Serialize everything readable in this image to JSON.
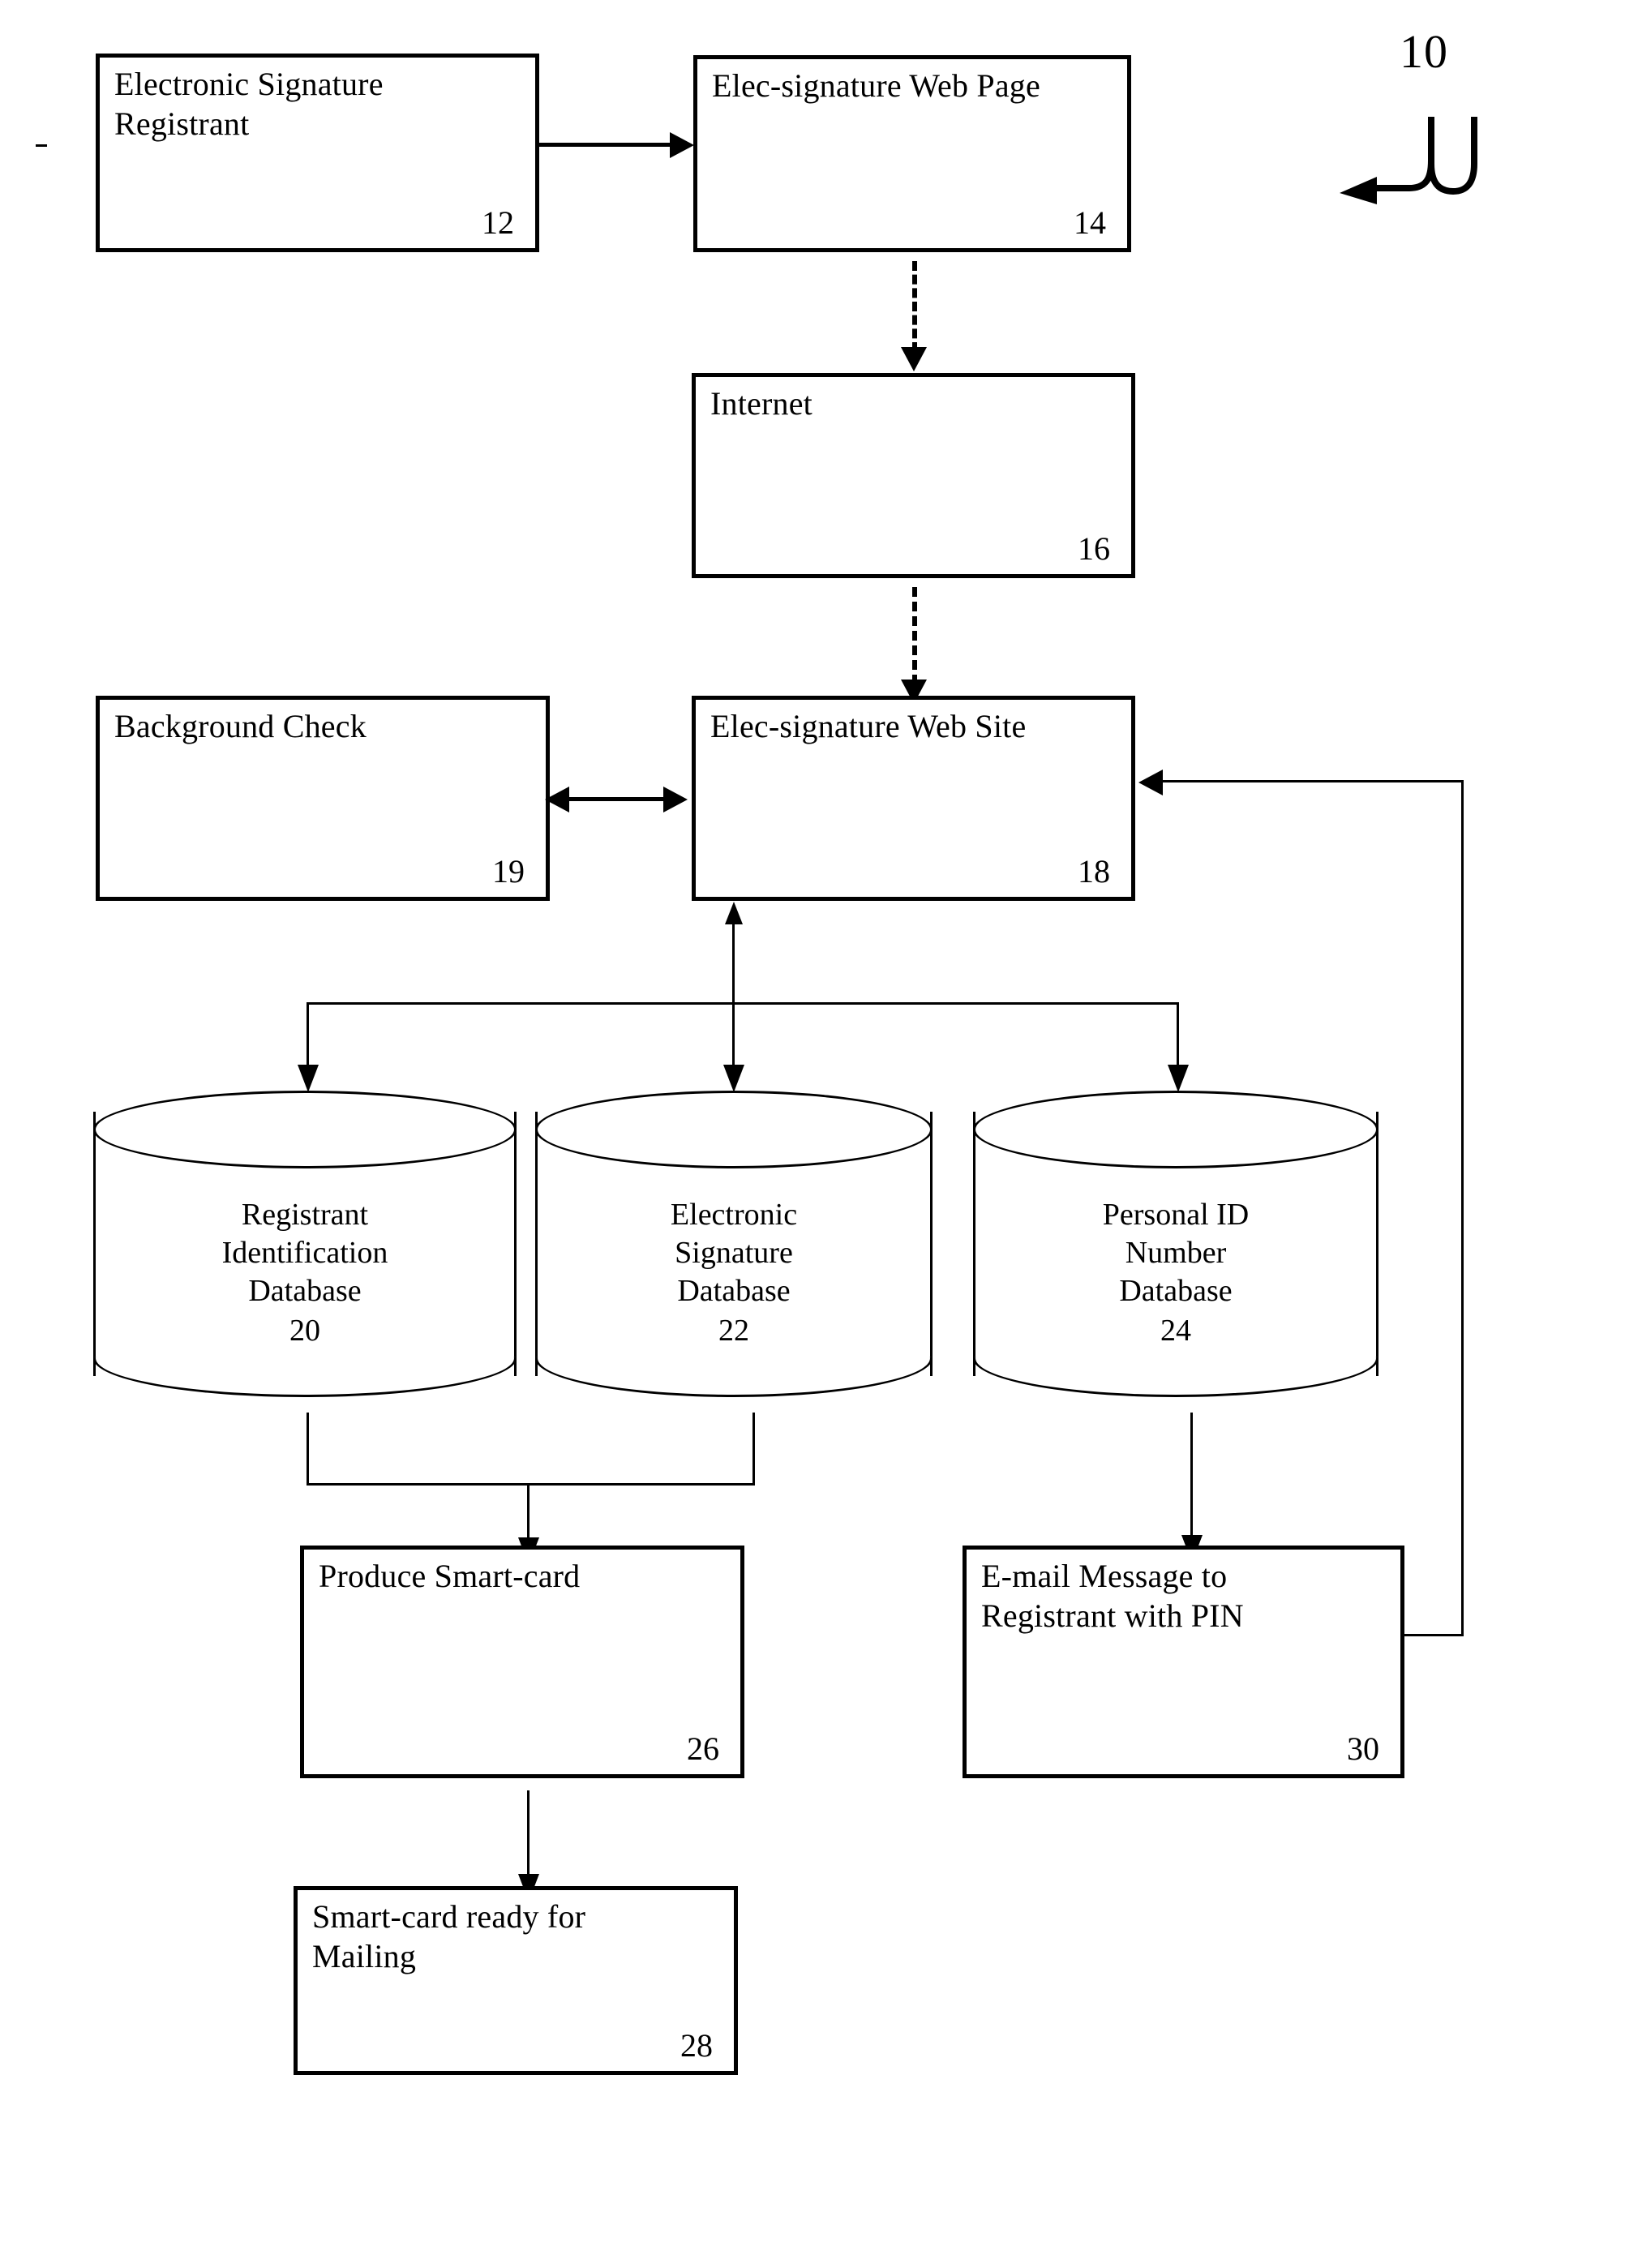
{
  "figure": {
    "reference_numeral": "10",
    "hook_arrow_icon": "curved-hook-arrow-icon"
  },
  "nodes": [
    {
      "id": "registrant",
      "label": "Electronic Signature\nRegistrant",
      "numeral": "12",
      "shape": "rect"
    },
    {
      "id": "web-page",
      "label": "Elec-signature Web Page",
      "numeral": "14",
      "shape": "rect"
    },
    {
      "id": "internet",
      "label": "Internet",
      "numeral": "16",
      "shape": "rect"
    },
    {
      "id": "background-check",
      "label": "Background Check",
      "numeral": "19",
      "shape": "rect"
    },
    {
      "id": "web-site",
      "label": "Elec-signature Web Site",
      "numeral": "18",
      "shape": "rect"
    },
    {
      "id": "registrant-id-db",
      "label": "Registrant\nIdentification\nDatabase",
      "numeral": "20",
      "shape": "cylinder"
    },
    {
      "id": "electronic-signature-db",
      "label": "Electronic\nSignature\nDatabase",
      "numeral": "22",
      "shape": "cylinder"
    },
    {
      "id": "personal-id-number-db",
      "label": "Personal ID\nNumber\nDatabase",
      "numeral": "24",
      "shape": "cylinder"
    },
    {
      "id": "produce-smart-card",
      "label": "Produce Smart-card",
      "numeral": "26",
      "shape": "rect"
    },
    {
      "id": "email-message",
      "label": "E-mail Message to\nRegistrant with PIN",
      "numeral": "30",
      "shape": "rect"
    },
    {
      "id": "smart-card-ready",
      "label": "Smart-card ready for\nMailing",
      "numeral": "28",
      "shape": "rect"
    }
  ],
  "edges": [
    {
      "from": "registrant",
      "to": "web-page",
      "style": "solid",
      "direction": "right"
    },
    {
      "from": "web-page",
      "to": "internet",
      "style": "dashed",
      "direction": "down"
    },
    {
      "from": "internet",
      "to": "web-site",
      "style": "dashed",
      "direction": "down"
    },
    {
      "from": "background-check",
      "to": "web-site",
      "style": "solid",
      "direction": "both"
    },
    {
      "from": "web-site",
      "to": "registrant-id-db",
      "style": "solid",
      "direction": "down"
    },
    {
      "from": "web-site",
      "to": "electronic-signature-db",
      "style": "solid",
      "direction": "both"
    },
    {
      "from": "web-site",
      "to": "personal-id-number-db",
      "style": "solid",
      "direction": "down"
    },
    {
      "from": "registrant-id-db",
      "to": "produce-smart-card",
      "style": "solid",
      "direction": "down"
    },
    {
      "from": "electronic-signature-db",
      "to": "produce-smart-card",
      "style": "solid",
      "direction": "down"
    },
    {
      "from": "personal-id-number-db",
      "to": "email-message",
      "style": "solid",
      "direction": "down"
    },
    {
      "from": "produce-smart-card",
      "to": "smart-card-ready",
      "style": "solid",
      "direction": "down"
    },
    {
      "from": "email-message",
      "to": "web-site",
      "style": "solid",
      "direction": "left"
    }
  ],
  "colors": {
    "line": "#000000",
    "background": "#ffffff"
  }
}
